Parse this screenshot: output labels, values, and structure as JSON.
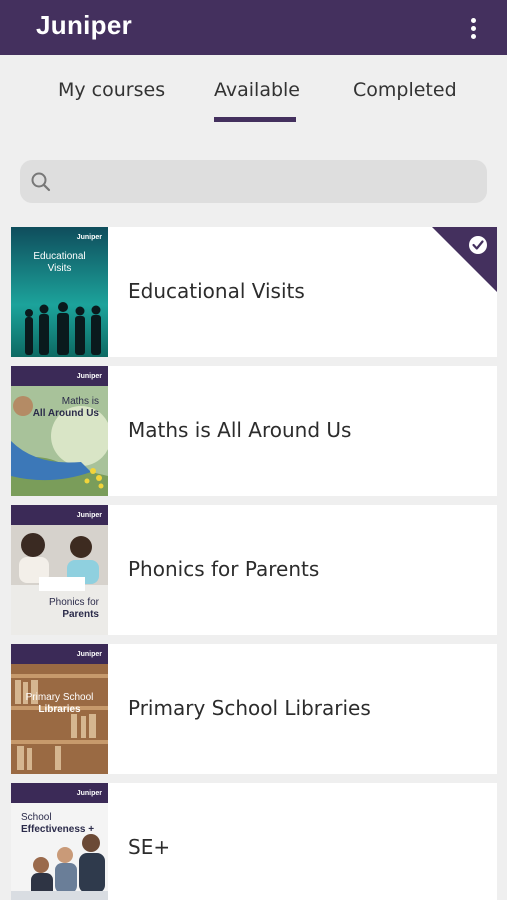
{
  "app": {
    "logo": "Juniper",
    "menu_icon": "more-vert-icon"
  },
  "tabs": [
    {
      "label": "My courses",
      "active": false
    },
    {
      "label": "Available",
      "active": true
    },
    {
      "label": "Completed",
      "active": false
    }
  ],
  "search": {
    "placeholder": "",
    "value": "",
    "icon": "search-icon"
  },
  "courses": [
    {
      "title": "Educational Visits",
      "cover_text": [
        "Educational",
        "Visits"
      ],
      "brand": "Juniper",
      "completed_badge": true
    },
    {
      "title": "Maths is All Around Us",
      "cover_text": [
        "Maths is",
        "All Around Us"
      ],
      "brand": "Juniper",
      "completed_badge": false
    },
    {
      "title": "Phonics for Parents",
      "cover_text": [
        "Phonics for",
        "Parents"
      ],
      "brand": "Juniper",
      "completed_badge": false
    },
    {
      "title": "Primary School Libraries",
      "cover_text": [
        "Primary School",
        "Libraries"
      ],
      "brand": "Juniper",
      "completed_badge": false
    },
    {
      "title": "SE+",
      "cover_text": [
        "School",
        "Effectiveness +"
      ],
      "brand": "Juniper",
      "completed_badge": false
    }
  ],
  "colors": {
    "primary": "#44305e",
    "background": "#efefef",
    "card": "#ffffff",
    "search_bg": "#dedede"
  }
}
